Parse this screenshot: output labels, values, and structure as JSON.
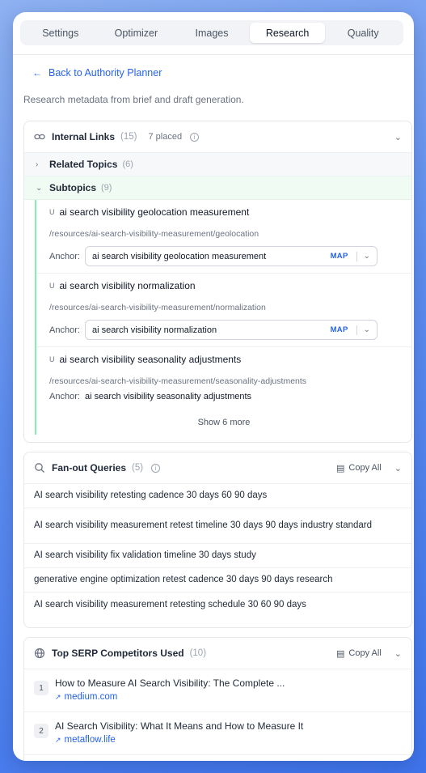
{
  "tabs": [
    "Settings",
    "Optimizer",
    "Images",
    "Research",
    "Quality"
  ],
  "active_tab": "Research",
  "back_link": "Back to Authority Planner",
  "description": "Research metadata from brief and draft generation.",
  "internal_links": {
    "title": "Internal Links",
    "count": "(15)",
    "placed": "7 placed",
    "related": {
      "label": "Related Topics",
      "count": "(6)"
    },
    "subtopics": {
      "label": "Subtopics",
      "count": "(9)"
    },
    "items": [
      {
        "keyword": "ai search visibility geolocation measurement",
        "path": "/resources/ai-search-visibility-measurement/geolocation",
        "anchor_label": "Anchor:",
        "anchor": "ai search visibility geolocation measurement",
        "map": "MAP"
      },
      {
        "keyword": "ai search visibility normalization",
        "path": "/resources/ai-search-visibility-measurement/normalization",
        "anchor_label": "Anchor:",
        "anchor": "ai search visibility normalization",
        "map": "MAP"
      },
      {
        "keyword": "ai search visibility seasonality adjustments",
        "path": "/resources/ai-search-visibility-measurement/seasonality-adjustments",
        "anchor_label": "Anchor:",
        "anchor": "ai search visibility seasonality adjustments"
      }
    ],
    "show_more": "Show 6 more"
  },
  "fanout": {
    "title": "Fan-out Queries",
    "count": "(5)",
    "copy_all": "Copy All",
    "queries": [
      "AI search visibility retesting cadence 30 days 60 90 days",
      "AI search visibility measurement retest timeline 30 days 90 days industry standard",
      "AI search visibility fix validation timeline 30 days study",
      "generative engine optimization retest cadence 30 days 90 days research",
      "AI search visibility measurement retesting schedule 30 60 90 days"
    ]
  },
  "serp": {
    "title": "Top SERP Competitors Used",
    "count": "(10)",
    "copy_all": "Copy All",
    "items": [
      {
        "rank": "1",
        "title": "How to Measure AI Search Visibility: The Complete ...",
        "domain": "medium.com"
      },
      {
        "rank": "2",
        "title": "AI Search Visibility: What It Means and How to Measure It",
        "domain": "metaflow.life"
      }
    ]
  },
  "colors": {
    "accent": "#2563eb",
    "subtopic_border": "#86efac",
    "background": "#5f8ef0"
  }
}
